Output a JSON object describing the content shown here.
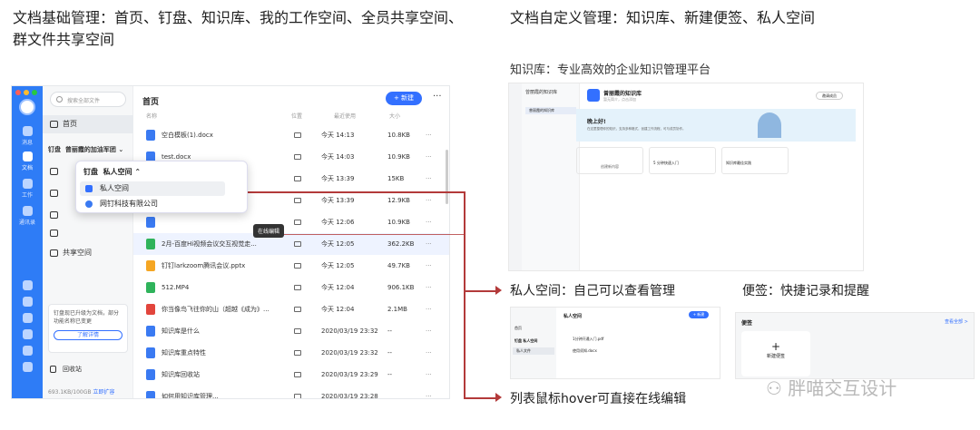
{
  "headings": {
    "left": "文档基础管理：首页、钉盘、知识库、我的工作空间、全员共享空间、群文件共享空间",
    "right": "文档自定义管理：知识库、新建便签、私人空间",
    "kb": "知识库：专业高效的企业知识管理平台",
    "private": "私人空间：自己可以查看管理",
    "notes": "便签：快捷记录和提醒",
    "hover": "列表鼠标hover可直接在线编辑"
  },
  "app": {
    "rail": [
      {
        "label": "消息"
      },
      {
        "label": "文档"
      },
      {
        "label": "工作"
      },
      {
        "label": "通讯录"
      }
    ],
    "search_placeholder": "搜索全部文件",
    "nav": {
      "home": "首页",
      "dingpan": "钉盘",
      "group_name": "曾丽霞的加油军团",
      "shared": "共享空间",
      "recycle": "回收站"
    },
    "upgrade_tip": "钉盘现已升级为文档，部分功能名称已变更",
    "upgrade_link": "了解详情",
    "storage": "693.1KB/100GB",
    "storage_link": "立即扩容",
    "main_title": "首页",
    "new_button": "+ 新建",
    "more": "···",
    "columns": {
      "name": "名称",
      "location": "位置",
      "recent": "最近使用",
      "size": "大小"
    },
    "rows": [
      {
        "name": "空白模板(1).docx",
        "time": "今天 14:13",
        "size": "10.8KB",
        "color": "#3a7af2"
      },
      {
        "name": "test.docx",
        "time": "今天 14:03",
        "size": "10.9KB",
        "color": "#3a7af2"
      },
      {
        "name": "",
        "time": "今天 13:39",
        "size": "15KB",
        "color": "#3a7af2"
      },
      {
        "name": "",
        "time": "今天 13:39",
        "size": "12.9KB",
        "color": "#3a7af2"
      },
      {
        "name": "",
        "time": "今天 12:06",
        "size": "10.9KB",
        "color": "#3a7af2"
      },
      {
        "name": "2月-百度Hi视频会议交互视觉走...",
        "time": "今天 12:05",
        "size": "362.2KB",
        "color": "#2fb35b"
      },
      {
        "name": "钉钉larkzoom腾讯会议.pptx",
        "time": "今天 12:05",
        "size": "49.7KB",
        "color": "#f5a623"
      },
      {
        "name": "512.MP4",
        "time": "今天 12:04",
        "size": "906.1KB",
        "color": "#2fb35b"
      },
      {
        "name": "你当像鸟飞往你的山（超越《成为》...",
        "time": "今天 12:04",
        "size": "2.1MB",
        "color": "#e2453c"
      },
      {
        "name": "知识库是什么",
        "time": "2020/03/19 23:32",
        "size": "--",
        "color": "#3a7af2"
      },
      {
        "name": "知识库重点特性",
        "time": "2020/03/19 23:32",
        "size": "--",
        "color": "#3a7af2"
      },
      {
        "name": "知识库回收站",
        "time": "2020/03/19 23:29",
        "size": "--",
        "color": "#3a7af2"
      },
      {
        "name": "如何用知识库管理...",
        "time": "2020/03/19 23:28",
        "size": "",
        "color": "#3a7af2"
      }
    ],
    "dropdown": {
      "header": "钉盘",
      "header2": "私人空间",
      "item1": "私人空间",
      "item2": "网钉科技有限公司"
    },
    "tooltip": "在线编辑"
  },
  "kb_shot": {
    "title": "曾丽霞的知识库",
    "subtitle": "暂无简介，点击添加",
    "nav_item": "曾丽霞的知识库",
    "banner_title": "晚上好!",
    "banner_sub": "在这里整理你的知识，支持多种格式，创建工作流程，可与成员协作。",
    "invite": "邀请成员",
    "cards": [
      "创建新内容",
      "5 分钟快速入门",
      "知识库最佳实践"
    ]
  },
  "private_shot": {
    "title": "私人空间",
    "new": "+ 新建",
    "nav": [
      "首页",
      "钉盘  私人空间",
      "私人文件"
    ],
    "files": [
      "1分钟开通入门.pdf",
      "使用须知.docx"
    ]
  },
  "notes_shot": {
    "title": "便签",
    "view_all": "查看全部 >",
    "new_note": "新建便签"
  },
  "watermark": "胖喵交互设计"
}
